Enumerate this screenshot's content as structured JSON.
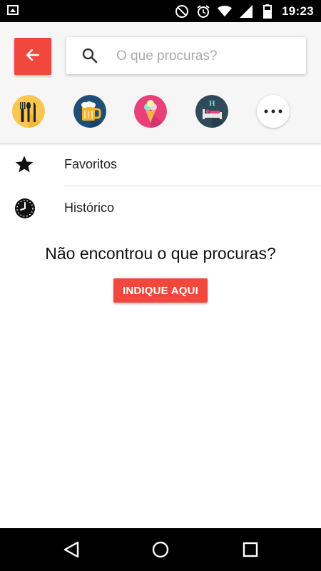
{
  "status_bar": {
    "time": "19:23",
    "icons": [
      "image-icon",
      "do-not-disturb-icon",
      "alarm-icon",
      "wifi-icon",
      "signal-icon",
      "battery-icon"
    ]
  },
  "header": {
    "back_icon": "arrow-left-icon",
    "search": {
      "placeholder": "O que procuras?",
      "value": "",
      "icon": "search-icon"
    },
    "categories": [
      {
        "icon": "restaurant-icon",
        "color": "#f9c74f"
      },
      {
        "icon": "beer-icon",
        "color": "#1f4e79"
      },
      {
        "icon": "ice-cream-icon",
        "color": "#e8407a"
      },
      {
        "icon": "hotel-icon",
        "color": "#2f4a5a"
      },
      {
        "icon": "more-icon",
        "color": "#ffffff"
      }
    ]
  },
  "list": {
    "items": [
      {
        "label": "Favoritos",
        "icon": "star-icon"
      },
      {
        "label": "Histórico",
        "icon": "clock-icon"
      }
    ]
  },
  "not_found": {
    "text": "Não encontrou o que procuras?",
    "button_label": "INDIQUE AQUI"
  },
  "nav_bar": {
    "icons": [
      "back-triangle-icon",
      "home-circle-icon",
      "recents-square-icon"
    ]
  },
  "colors": {
    "accent": "#f2473d",
    "header_bg": "#f6f6f6"
  }
}
